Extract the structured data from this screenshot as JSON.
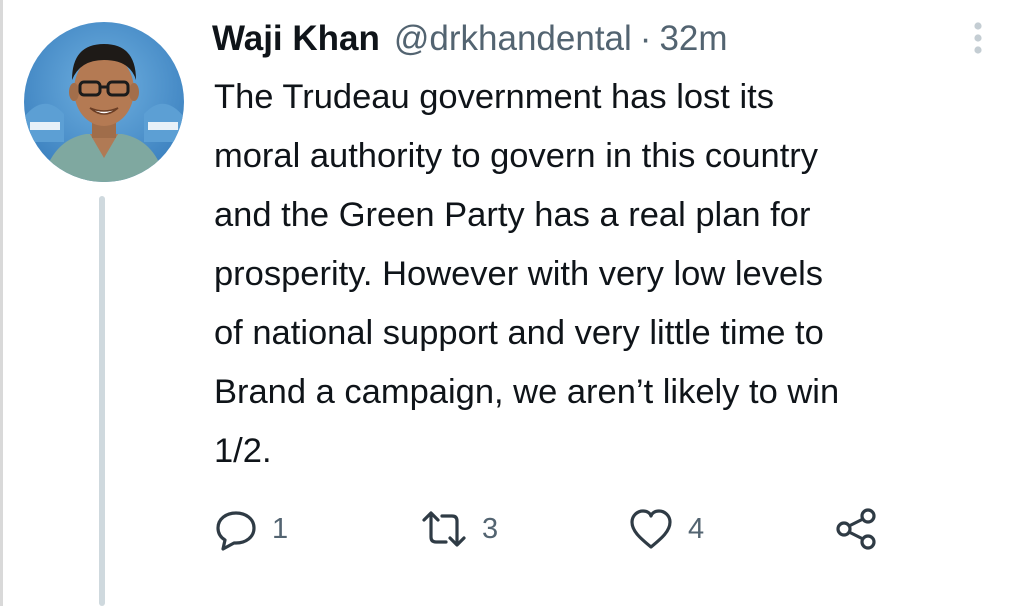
{
  "tweet": {
    "author": {
      "name": "Waji Khan",
      "handle": "@drkhandental",
      "avatar_icon": "profile-photo-icon"
    },
    "separator": "·",
    "time": "32m",
    "text_lines": [
      "The Trudeau government has lost its",
      "moral authority to govern in this country",
      "and the Green Party has a real plan for",
      "prosperity.  However with very low levels",
      "of national support and very little time to",
      "Brand a campaign, we aren’t likely to win",
      "1/2."
    ],
    "actions": {
      "reply": {
        "icon": "reply-icon",
        "count": "1"
      },
      "retweet": {
        "icon": "retweet-icon",
        "count": "3"
      },
      "like": {
        "icon": "heart-icon",
        "count": "4"
      },
      "share": {
        "icon": "share-icon"
      }
    },
    "more_icon": "more-options-icon"
  },
  "colors": {
    "text": "#0f1419",
    "secondary": "#536471",
    "thread_line": "#cfd9de",
    "avatar_bg": "#4a90c8"
  }
}
